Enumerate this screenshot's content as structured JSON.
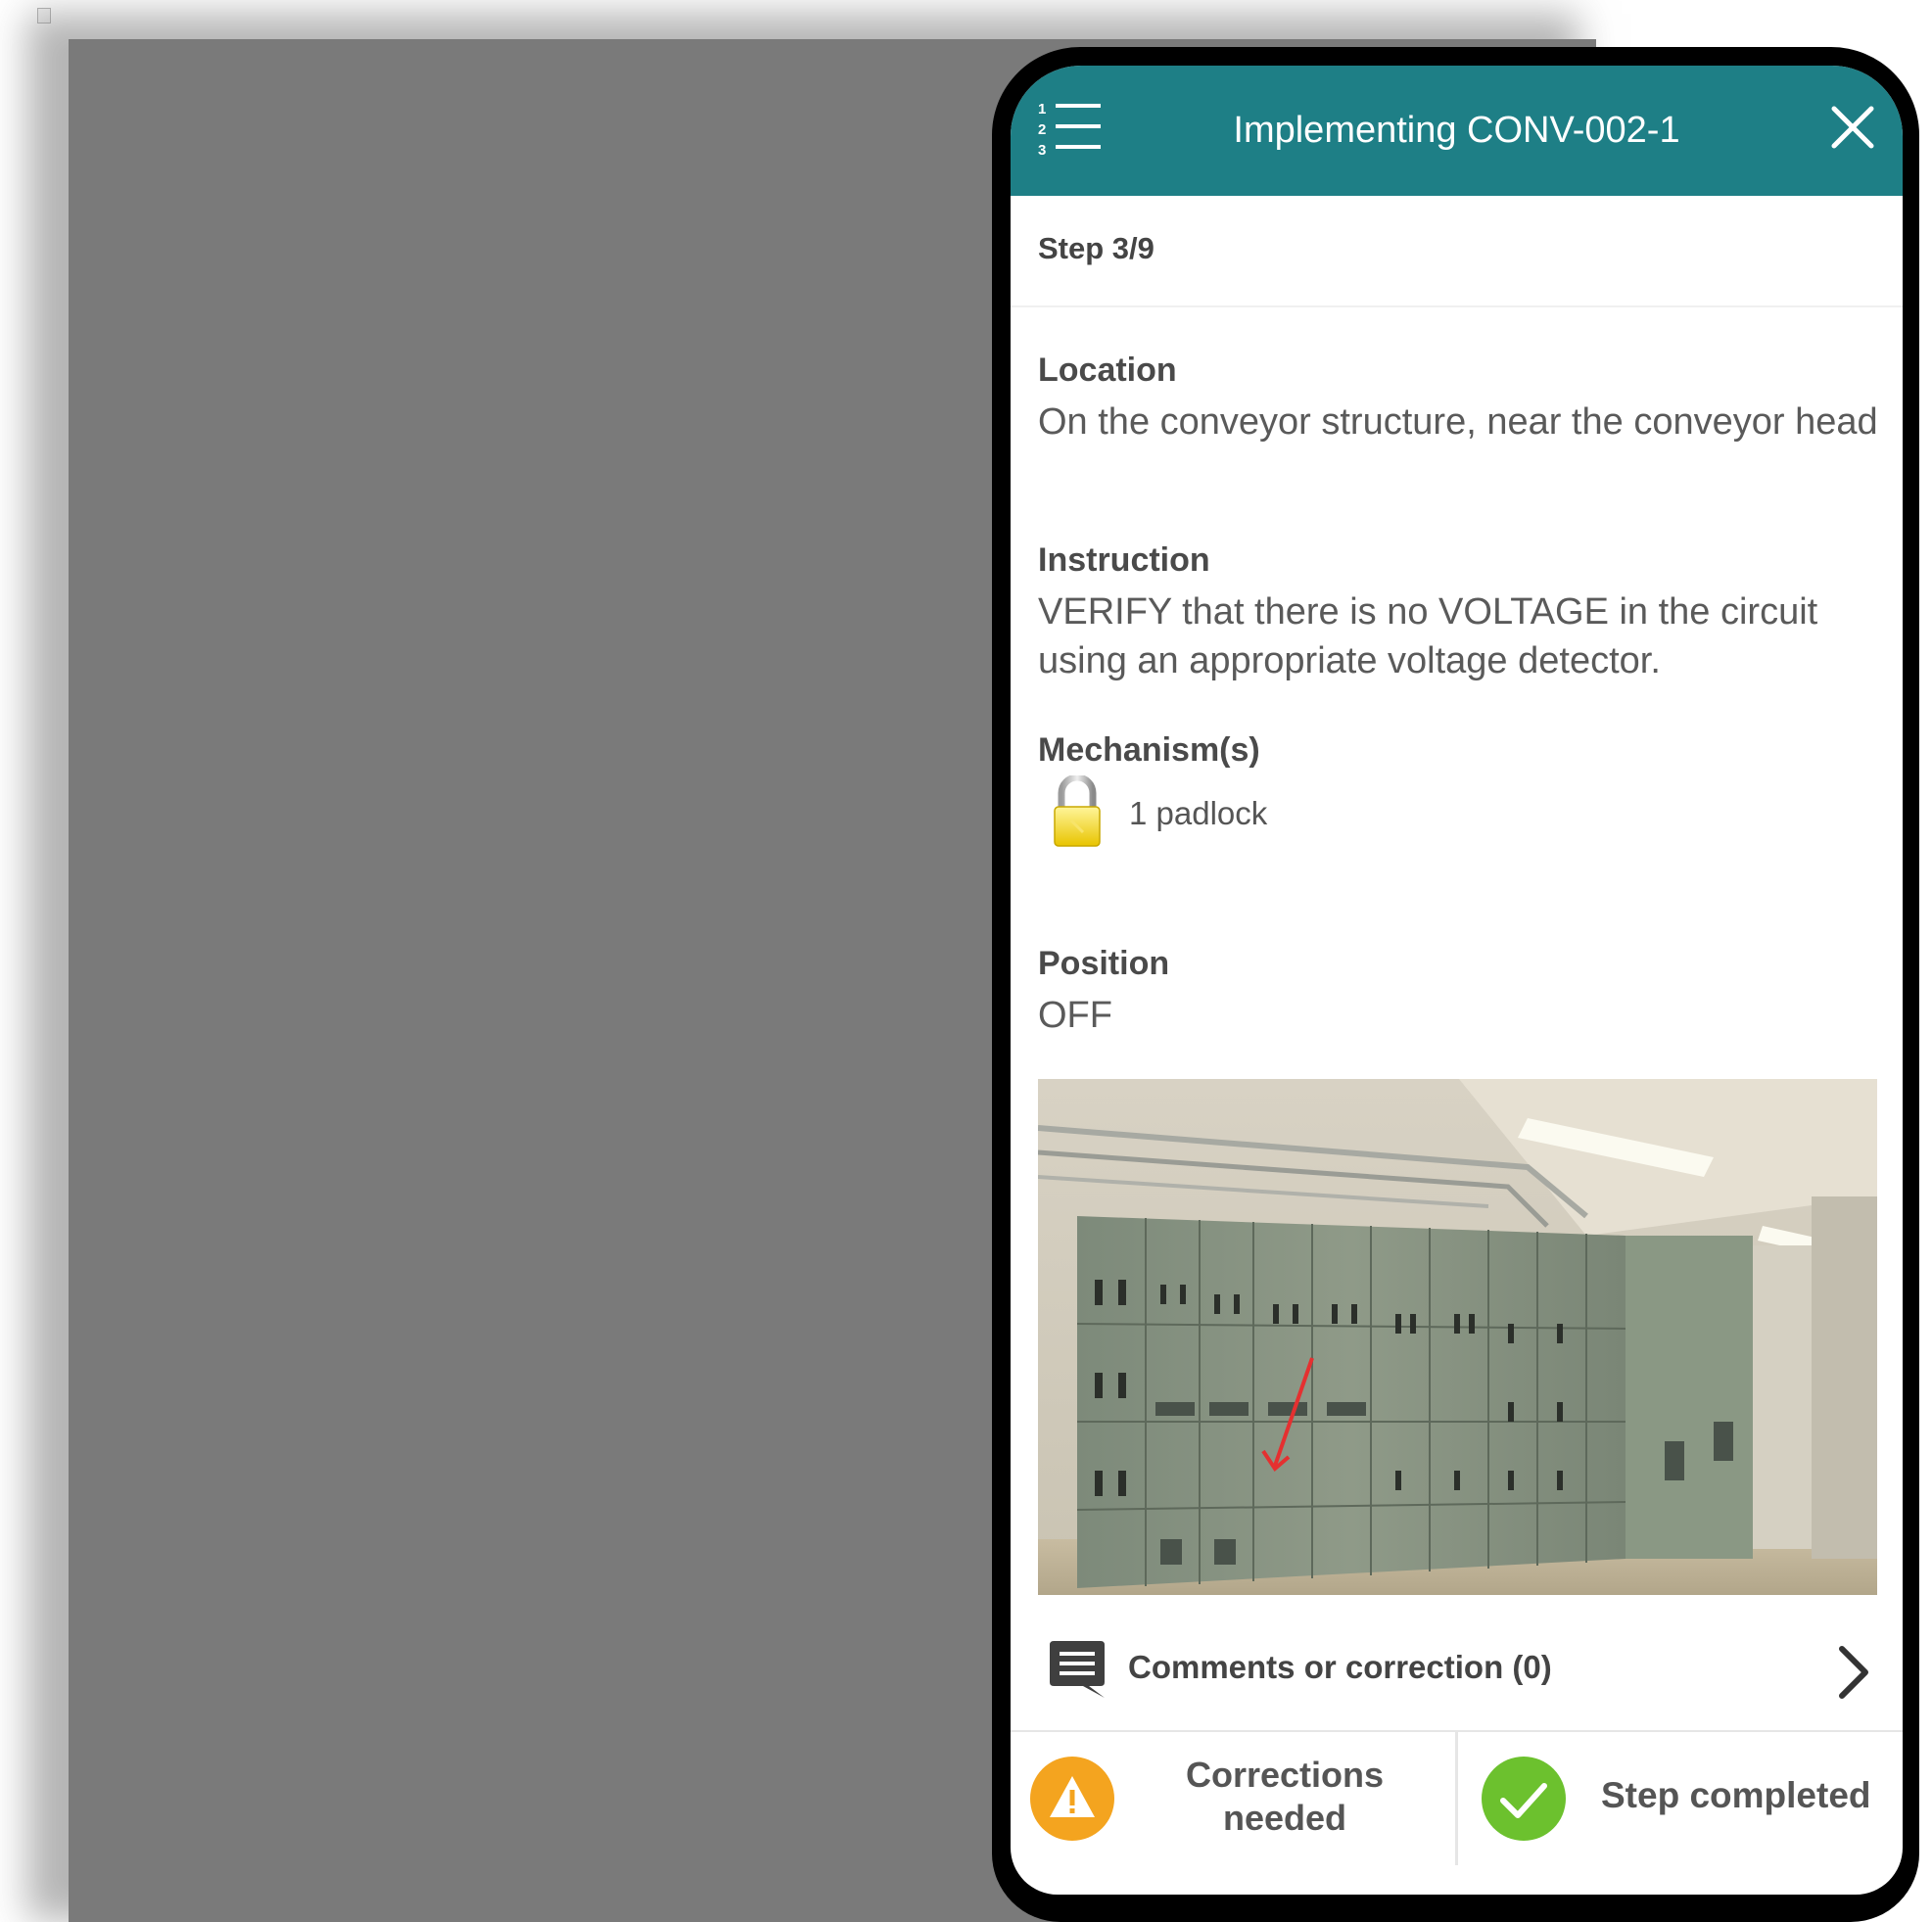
{
  "app": {
    "title": "Implementing CONV-002-1",
    "step": "Step 3/9",
    "accent_color": "#1e7f86"
  },
  "icons": {
    "menu": "numbered-list-icon",
    "close": "close-icon",
    "padlock": "padlock-icon",
    "comments": "comment-icon",
    "chevron": "chevron-right-icon",
    "warning": "warning-icon",
    "check": "check-icon"
  },
  "sections": {
    "location": {
      "label": "Location",
      "value": "On the conveyor structure, near the conveyor head"
    },
    "instruction": {
      "label": "Instruction",
      "value": "VERIFY that there is no VOLTAGE in the circuit using an appropriate voltage detector."
    },
    "mechanisms": {
      "label": "Mechanism(s)",
      "items": [
        "1 padlock"
      ]
    },
    "position": {
      "label": "Position",
      "value": "OFF"
    }
  },
  "comments": {
    "label": "Comments or correction (0)"
  },
  "actions": {
    "corrections_line1": "Corrections",
    "corrections_line2": "needed",
    "corrections_color": "#f4a41f",
    "step_completed": "Step completed",
    "completed_color": "#6cc12e"
  }
}
